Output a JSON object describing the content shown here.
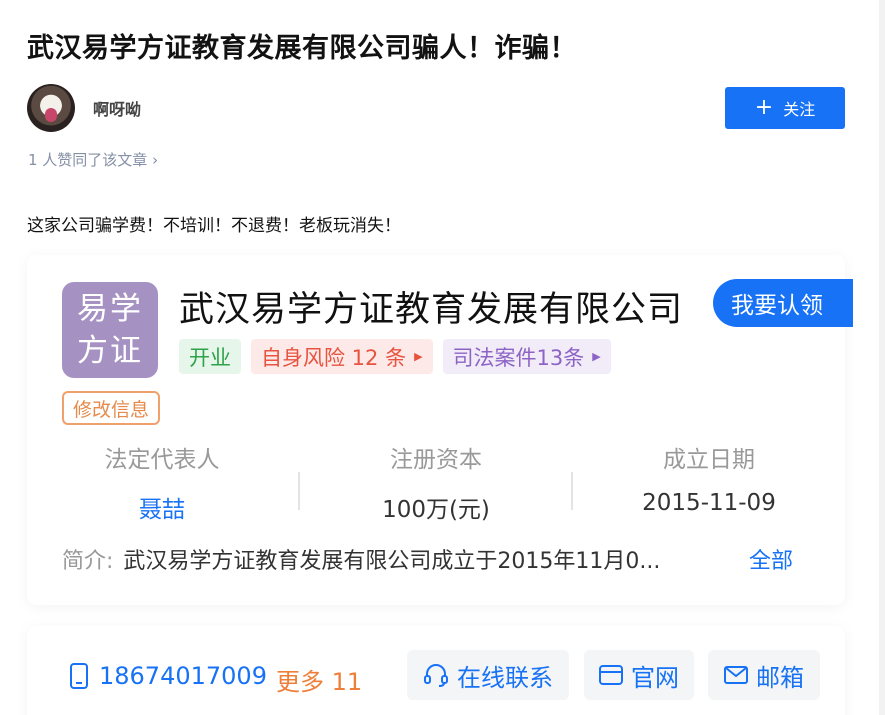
{
  "article": {
    "title": "武汉易学方证教育发展有限公司骗人！诈骗！",
    "likes_text": "1 人赞同了该文章 ›",
    "content": "这家公司骗学费！不培训！不退费！老板玩消失！"
  },
  "author": {
    "name": "啊呀呦",
    "follow_label": "关注"
  },
  "company": {
    "logo_line1": "易学",
    "logo_line2": "方证",
    "name": "武汉易学方证教育发展有限公司",
    "claim_label": "我要认领",
    "tags": {
      "status": "开业",
      "risk": "自身风险 12 条",
      "legal": "司法案件13条"
    },
    "edit_label": "修改信息",
    "stats": [
      {
        "label": "法定代表人",
        "value": "聂喆"
      },
      {
        "label": "注册资本",
        "value": "100万(元)"
      },
      {
        "label": "成立日期",
        "value": "2015-11-09"
      }
    ],
    "intro_label": "简介:",
    "intro_text": "武汉易学方证教育发展有限公司成立于2015年11月0...",
    "intro_more": "全部"
  },
  "contact": {
    "phone": "18674017009",
    "more": "更多 11",
    "online": "在线联系",
    "website": "官网",
    "email": "邮箱"
  },
  "colors": {
    "brand_blue": "#1772f6",
    "logo_purple": "#a592c3",
    "open_green": "#2fa24a",
    "risk_red": "#e8533f",
    "legal_purple": "#8d63c6",
    "more_orange": "#ee7f3a"
  }
}
